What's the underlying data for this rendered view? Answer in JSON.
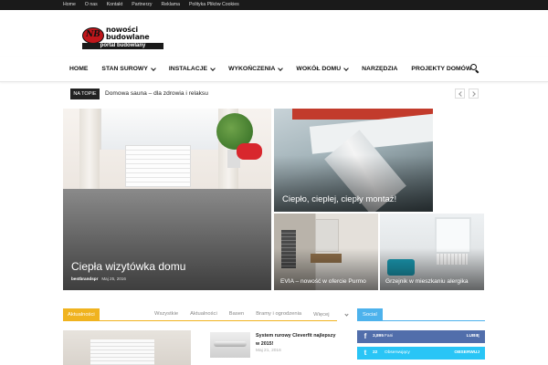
{
  "topbar": {
    "links": [
      "Home",
      "O nas",
      "Kontakt",
      "Partnerzy",
      "Reklama",
      "Polityka Plików Cookies"
    ]
  },
  "logo": {
    "badge": "NB",
    "word1": "nowości",
    "word2": "budowlane",
    "strip": "portal budowlany"
  },
  "nav": {
    "items": [
      {
        "label": "HOME",
        "has_dropdown": false
      },
      {
        "label": "STAN SUROWY",
        "has_dropdown": true
      },
      {
        "label": "INSTALACJE",
        "has_dropdown": true
      },
      {
        "label": "WYKOŃCZENIA",
        "has_dropdown": true
      },
      {
        "label": "WOKÓŁ DOMU",
        "has_dropdown": true
      },
      {
        "label": "NARZĘDZIA",
        "has_dropdown": false
      },
      {
        "label": "PROJEKTY DOMÓW",
        "has_dropdown": false
      }
    ],
    "search_icon": "search-icon"
  },
  "ticker": {
    "tag": "NA TOPIE",
    "headline": "Domowa sauna – dla zdrowia i relaksu"
  },
  "featured": {
    "main": {
      "title": "Ciepła wizytówka domu",
      "author": "bestbrandspr",
      "date": "Maj 25, 2016"
    },
    "top_right": {
      "title": "Ciepło, cieplej, ciepły montaż!"
    },
    "bottom_left": {
      "title": "EVIA – nowość w ofercie Purmo"
    },
    "bottom_right": {
      "title": "Grzejnik w mieszkaniu alergika"
    }
  },
  "news_block": {
    "label": "Aktualności",
    "filters": [
      "Wszystkie",
      "Aktualności",
      "Basen",
      "Bramy i ogrodzenia"
    ],
    "more": "Więcej",
    "post": {
      "title": "System rurowy Cleverfit najlepszy w 2015!",
      "date": "Maj 21, 2016"
    }
  },
  "social": {
    "label": "Social",
    "rows": [
      {
        "network": "facebook",
        "icon": "f",
        "count": "3,895",
        "label": "Fani",
        "action": "LUBIĘ",
        "color": "#516eab"
      },
      {
        "network": "twitter",
        "icon": "t",
        "count": "22",
        "label": "Obserwujący",
        "action": "OBSERWUJ",
        "color": "#29c5f6"
      }
    ]
  },
  "colors": {
    "accent": "#f0b31f",
    "social_accent": "#4db2ec",
    "topbar": "#1a1a1a",
    "logo_red": "#c0161b"
  }
}
